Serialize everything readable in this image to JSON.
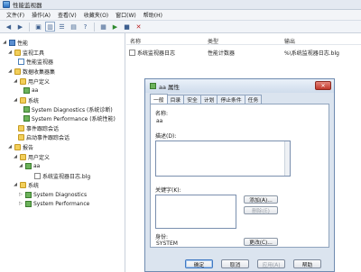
{
  "window": {
    "title": "性能监视器"
  },
  "menu": [
    "文件(F)",
    "操作(A)",
    "查看(V)",
    "收藏夹(O)",
    "窗口(W)",
    "帮助(H)"
  ],
  "toolbar": [
    "back-icon",
    "forward-icon",
    "up-icon",
    "show-hide-tree-icon",
    "list-view-icon",
    "properties-icon",
    "help-icon",
    "new-icon",
    "start-icon",
    "stop-icon",
    "delete-icon"
  ],
  "tree": {
    "root": "性能",
    "monitoring_tools": "监视工具",
    "perf_monitor": "性能监视器",
    "data_collector_sets": "数据收集器集",
    "user_defined": "用户定义",
    "aa": "aa",
    "system": "系统",
    "sys_diag": "System Diagnostics (系统诊断)",
    "sys_perf": "System Performance (系统性能)",
    "event_trace": "事件跟踪会话",
    "startup_event": "启动事件跟踪会话",
    "reports": "报告",
    "rpt_user_defined": "用户定义",
    "rpt_aa": "aa",
    "rpt_log": "系统监视器日志.blg",
    "rpt_system": "系统",
    "rpt_sys_diag": "System Diagnostics",
    "rpt_sys_perf": "System Performance"
  },
  "list": {
    "columns": [
      "名称",
      "类型",
      "输出"
    ],
    "rows": [
      {
        "name": "系统监视器日志",
        "type": "性能计数器",
        "output": "%\\系统监视器日志.blg"
      }
    ]
  },
  "dialog": {
    "title": "aa 属性",
    "close": "✕",
    "tabs": [
      "一般",
      "目录",
      "安全",
      "计划",
      "停止条件",
      "任务"
    ],
    "active_tab": 0,
    "name_label": "名称:",
    "name_value": "aa",
    "description_label": "描述(D):",
    "keywords_label": "关键字(K):",
    "add_button": "添加(A)...",
    "delete_button": "删除(E)",
    "run_as_label": "身份:",
    "run_as_value": "SYSTEM",
    "change_button": "更改(C)...",
    "ok_button": "确定",
    "cancel_button": "取消",
    "apply_button": "应用(A)",
    "help_button": "帮助"
  }
}
